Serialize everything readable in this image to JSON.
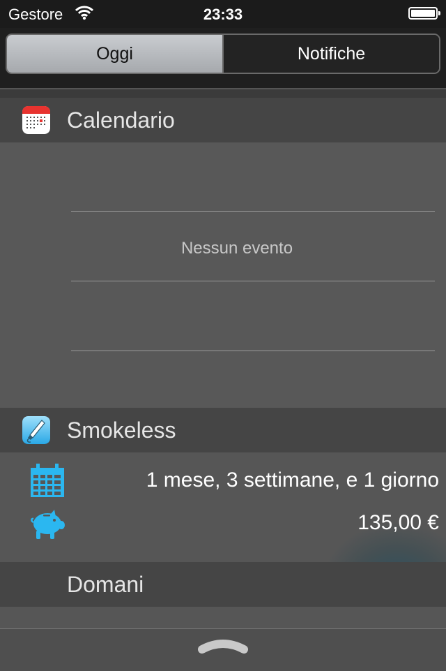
{
  "status_bar": {
    "carrier": "Gestore",
    "time": "23:33"
  },
  "segmented": {
    "tabs": [
      "Oggi",
      "Notifiche"
    ],
    "selected": "Oggi"
  },
  "calendar": {
    "title": "Calendario",
    "empty_text": "Nessun evento"
  },
  "smokeless": {
    "title": "Smokeless",
    "duration": "1 mese, 3 settimane, e 1 giorno",
    "savings": "135,00 €"
  },
  "tomorrow": {
    "title": "Domani"
  },
  "icons": {
    "wifi": "wifi-icon",
    "battery": "battery-icon",
    "calendar_app": "calendar-app-icon",
    "smokeless_app": "smokeless-app-icon",
    "calendar": "calendar-grid-icon",
    "piggy_bank": "piggy-bank-icon",
    "handle": "chevron-up-handle-icon"
  },
  "colors": {
    "accent": "#2bb7f0",
    "calendar_red": "#e8332f",
    "segment_active": "#b8bbbf"
  }
}
